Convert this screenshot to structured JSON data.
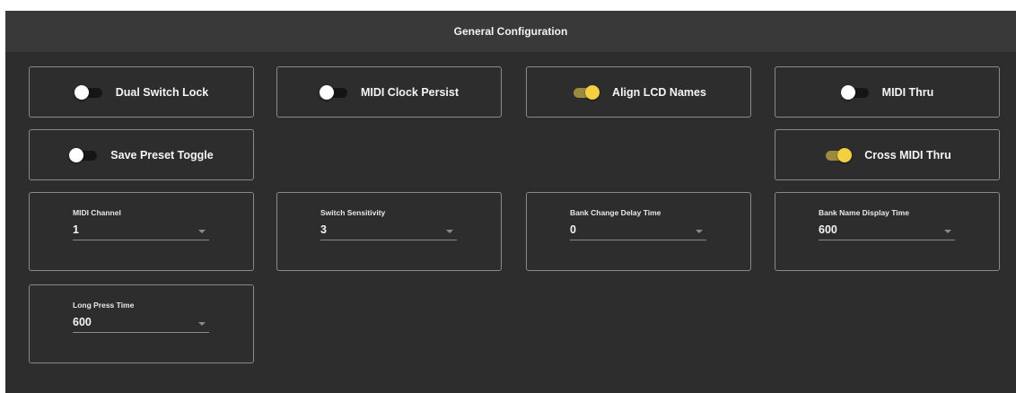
{
  "header": {
    "title": "General Configuration"
  },
  "toggles": [
    {
      "label": "Dual Switch Lock",
      "on": false
    },
    {
      "label": "MIDI Clock Persist",
      "on": false
    },
    {
      "label": "Align LCD Names",
      "on": true
    },
    {
      "label": "MIDI Thru",
      "on": false
    },
    {
      "label": "Save Preset Toggle",
      "on": false
    },
    {
      "label": "Cross MIDI Thru",
      "on": true
    }
  ],
  "selects": [
    {
      "label": "MIDI Channel",
      "value": "1"
    },
    {
      "label": "Switch Sensitivity",
      "value": "3"
    },
    {
      "label": "Bank Change Delay Time",
      "value": "0"
    },
    {
      "label": "Bank Name Display Time",
      "value": "600"
    },
    {
      "label": "Long Press Time",
      "value": "600"
    }
  ],
  "colors": {
    "panel": "#2d2d2d",
    "header": "#393939",
    "toggle_on_thumb": "#f4cf3f",
    "toggle_on_track": "#9c8a3e",
    "toggle_off_thumb": "#ffffff"
  }
}
